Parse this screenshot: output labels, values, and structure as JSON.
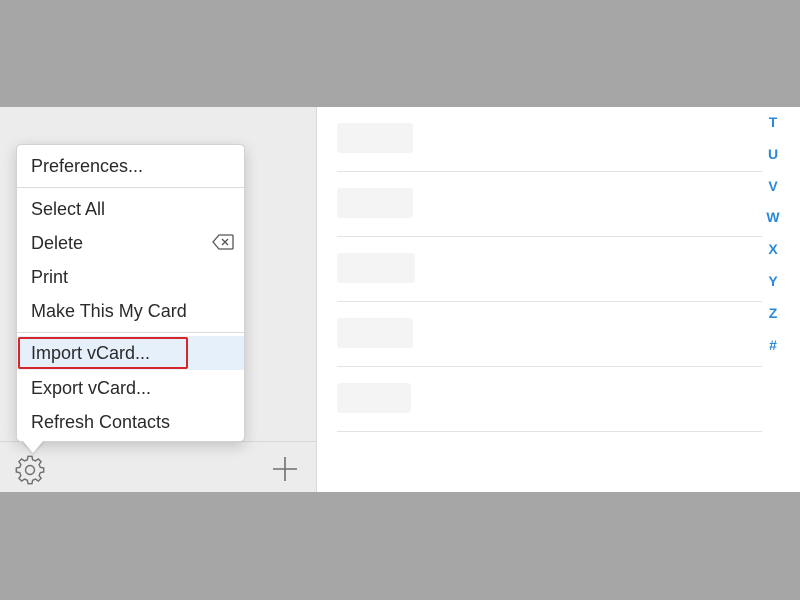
{
  "menu": {
    "items": [
      {
        "label": "Preferences..."
      },
      {
        "label": "Select All"
      },
      {
        "label": "Delete",
        "shortcut_icon": "delete-key-icon"
      },
      {
        "label": "Print"
      },
      {
        "label": "Make This My Card"
      },
      {
        "label": "Import vCard...",
        "highlighted": true,
        "outlined": true,
        "outline_color": "#d7262b"
      },
      {
        "label": "Export vCard..."
      },
      {
        "label": "Refresh Contacts"
      }
    ]
  },
  "footer": {
    "settings_icon": "gear-icon",
    "add_icon": "plus-icon"
  },
  "index": {
    "letters": [
      "T",
      "U",
      "V",
      "W",
      "X",
      "Y",
      "Z",
      "#"
    ],
    "color": "#2a88d8"
  }
}
